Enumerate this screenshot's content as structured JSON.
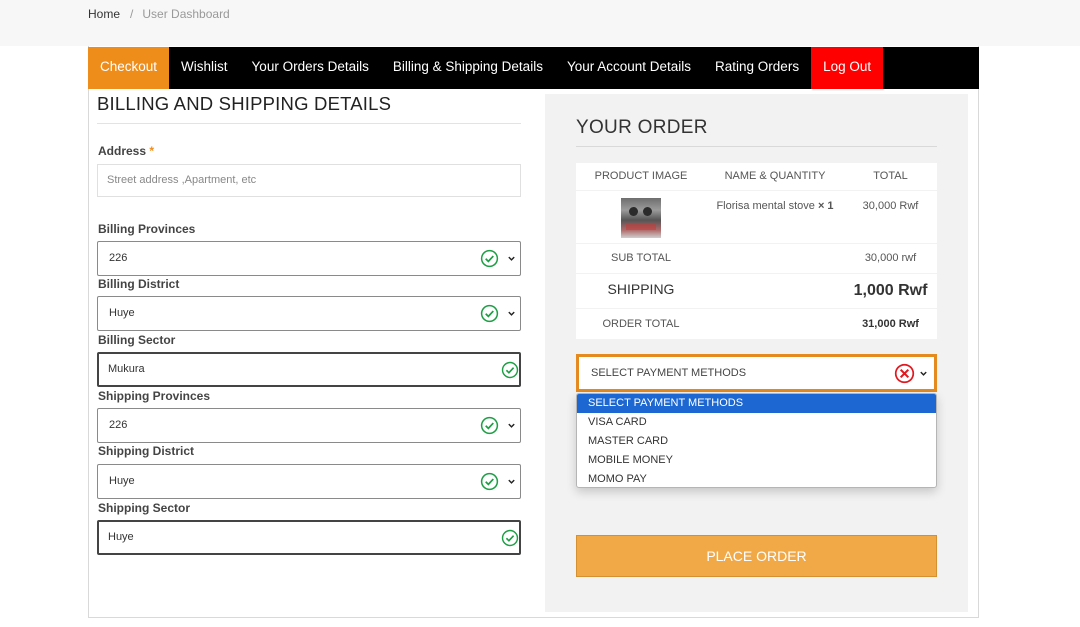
{
  "breadcrumb": {
    "home": "Home",
    "separator": "/",
    "current": "User Dashboard"
  },
  "nav": {
    "tabs": [
      {
        "label": "Checkout"
      },
      {
        "label": "Wishlist"
      },
      {
        "label": "Your Orders Details"
      },
      {
        "label": "Billing & Shipping Details"
      },
      {
        "label": "Your Account Details"
      },
      {
        "label": "Rating Orders"
      },
      {
        "label": "Log Out"
      }
    ]
  },
  "billing": {
    "title": "BILLING AND SHIPPING DETAILS",
    "address_label": "Address",
    "required_mark": "*",
    "address_placeholder": "Street address ,Apartment, etc",
    "fields": [
      {
        "label": "Billing Provinces",
        "value": "226"
      },
      {
        "label": "Billing District",
        "value": "Huye"
      },
      {
        "label": "Billing Sector",
        "value": "Mukura"
      },
      {
        "label": "Shipping Provinces",
        "value": "226"
      },
      {
        "label": "Shipping District",
        "value": "Huye"
      },
      {
        "label": "Shipping Sector",
        "value": "Huye"
      }
    ]
  },
  "order": {
    "title": "YOUR ORDER",
    "headers": {
      "image": "PRODUCT IMAGE",
      "name_qty": "NAME & QUANTITY",
      "total": "TOTAL"
    },
    "item": {
      "name": "Florisa mental stove",
      "qty": "× 1",
      "total": "30,000 Rwf"
    },
    "subtotal": {
      "label": "SUB TOTAL",
      "value": "30,000 rwf"
    },
    "shipping": {
      "label": "SHIPPING",
      "value": "1,000 Rwf"
    },
    "order_total": {
      "label": "ORDER TOTAL",
      "value": "31,000 Rwf"
    }
  },
  "payment": {
    "selected": "SELECT PAYMENT METHODS",
    "options": [
      "SELECT PAYMENT METHODS",
      "VISA CARD",
      "MASTER CARD",
      "MOBILE MONEY",
      "MOMO PAY"
    ]
  },
  "place_order_label": "PLACE ORDER",
  "colors": {
    "accent": "#ef8d1a",
    "logout": "#ff0000",
    "valid": "#1e9e45",
    "invalid": "#e0181f",
    "option_highlight": "#1d67d3",
    "button": "#f1a948"
  }
}
